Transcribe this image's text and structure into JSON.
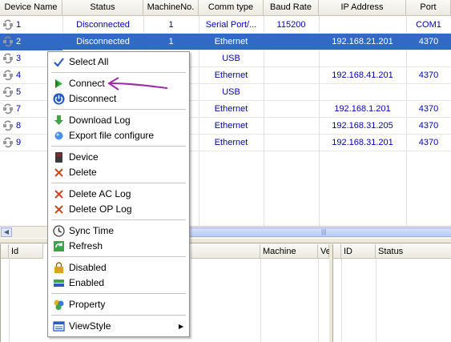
{
  "columns": [
    "Device Name",
    "Status",
    "MachineNo.",
    "Comm type",
    "Baud Rate",
    "IP Address",
    "Port"
  ],
  "rows": [
    {
      "name": "1",
      "status": "Disconnected",
      "machine": "1",
      "comm": "Serial Port/...",
      "baud": "115200",
      "ip": "",
      "port": "COM1"
    },
    {
      "name": "2",
      "status": "Disconnected",
      "machine": "1",
      "comm": "Ethernet",
      "baud": "",
      "ip": "192.168.21.201",
      "port": "4370"
    },
    {
      "name": "3",
      "status": "",
      "machine": "",
      "comm": "USB",
      "baud": "",
      "ip": "",
      "port": ""
    },
    {
      "name": "4",
      "status": "",
      "machine": "",
      "comm": "Ethernet",
      "baud": "",
      "ip": "192.168.41.201",
      "port": "4370"
    },
    {
      "name": "5",
      "status": "",
      "machine": "",
      "comm": "USB",
      "baud": "",
      "ip": "",
      "port": ""
    },
    {
      "name": "7",
      "status": "",
      "machine": "",
      "comm": "Ethernet",
      "baud": "",
      "ip": "192.168.1.201",
      "port": "4370"
    },
    {
      "name": "8",
      "status": "",
      "machine": "",
      "comm": "Ethernet",
      "baud": "",
      "ip": "192.168.31.205",
      "port": "4370"
    },
    {
      "name": "9",
      "status": "",
      "machine": "",
      "comm": "Ethernet",
      "baud": "",
      "ip": "192.168.31.201",
      "port": "4370"
    }
  ],
  "bottom_left": {
    "col_id": "Id",
    "col_machine": "Machine",
    "col_ve": "Ve"
  },
  "bottom_right": {
    "col_id": "ID",
    "col_status": "Status"
  },
  "scroll_grip": "|||",
  "menu": {
    "select_all": "Select All",
    "connect": "Connect",
    "disconnect": "Disconnect",
    "download_log": "Download Log",
    "export_file": "Export file configure",
    "device": "Device",
    "delete": "Delete",
    "delete_ac": "Delete AC Log",
    "delete_op": "Delete OP Log",
    "sync_time": "Sync Time",
    "refresh": "Refresh",
    "disabled": "Disabled",
    "enabled": "Enabled",
    "property": "Property",
    "viewstyle": "ViewStyle"
  },
  "colors": {
    "selection": "#316ac5",
    "link_text": "#0000c0",
    "annotation_arrow": "#9b2ea8"
  }
}
